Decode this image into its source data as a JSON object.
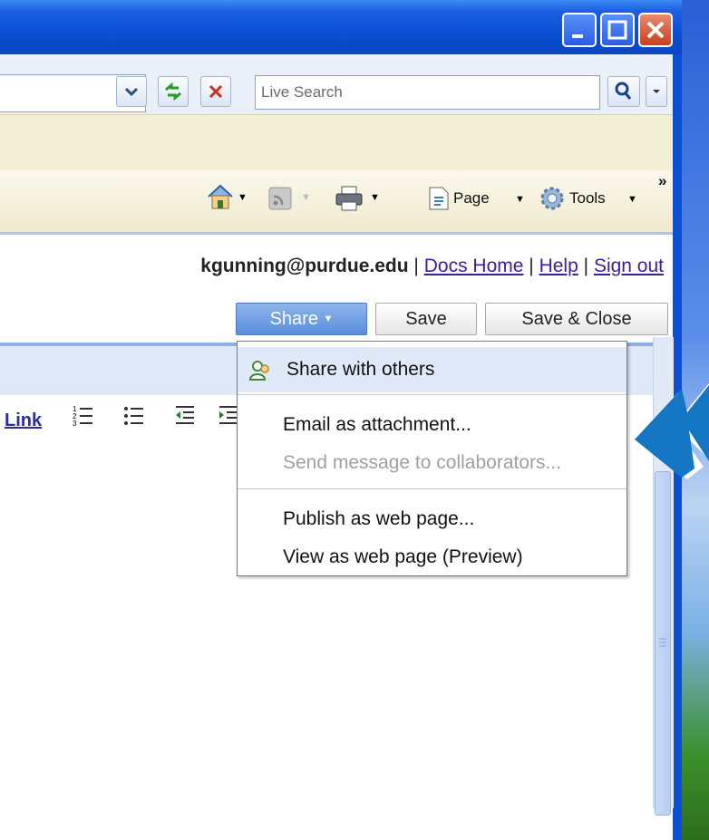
{
  "browser": {
    "search_placeholder": "Live Search",
    "command_bar": {
      "page_label": "Page",
      "tools_label": "Tools",
      "overflow": "»"
    }
  },
  "docs": {
    "user_email": "kgunning@purdue.edu",
    "separator": "|",
    "links": [
      "Docs Home",
      "Help",
      "Sign out"
    ],
    "buttons": {
      "share": "Share",
      "save": "Save",
      "save_close": "Save & Close"
    },
    "toolbar_link": "Link"
  },
  "share_menu": {
    "items": [
      {
        "label": "Share with others",
        "enabled": true,
        "highlighted": true
      },
      {
        "label": "Email as attachment...",
        "enabled": true
      },
      {
        "label": "Send message to collaborators...",
        "enabled": false
      },
      {
        "label": "Publish as web page...",
        "enabled": true
      },
      {
        "label": "View as web page (Preview)",
        "enabled": true
      }
    ]
  },
  "colors": {
    "xp_blue": "#0a4fd4",
    "share_button": "#5a8edc",
    "arrow": "#1576c4",
    "link": "#3b1e9a",
    "disabled_text": "#a0a0a0"
  }
}
